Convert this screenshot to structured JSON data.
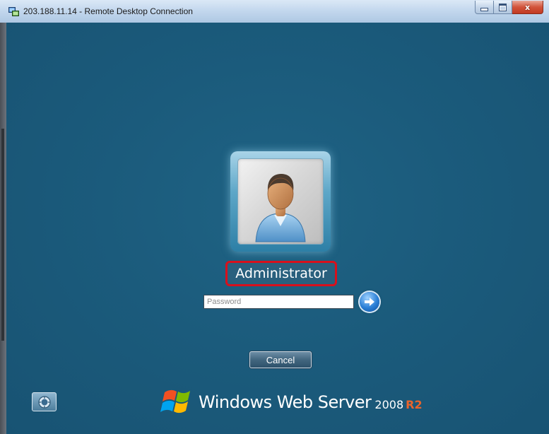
{
  "window": {
    "title": "203.188.11.14 - Remote Desktop Connection",
    "controls": {
      "minimize": "minimize",
      "maximize": "maximize",
      "close": "x"
    }
  },
  "logon": {
    "username": "Administrator",
    "password": {
      "placeholder": "Password",
      "value": ""
    },
    "submit_icon": "arrow-right-icon",
    "cancel_label": "Cancel"
  },
  "ease_of_access": {
    "icon": "ease-of-access-icon"
  },
  "branding": {
    "name": "Windows Web Server",
    "year": "2008",
    "release": "R2"
  },
  "colors": {
    "session_bg": "#1b5b7c",
    "highlight_border": "#d8101c",
    "release_accent": "#e8642c",
    "text": "#ffffff"
  }
}
